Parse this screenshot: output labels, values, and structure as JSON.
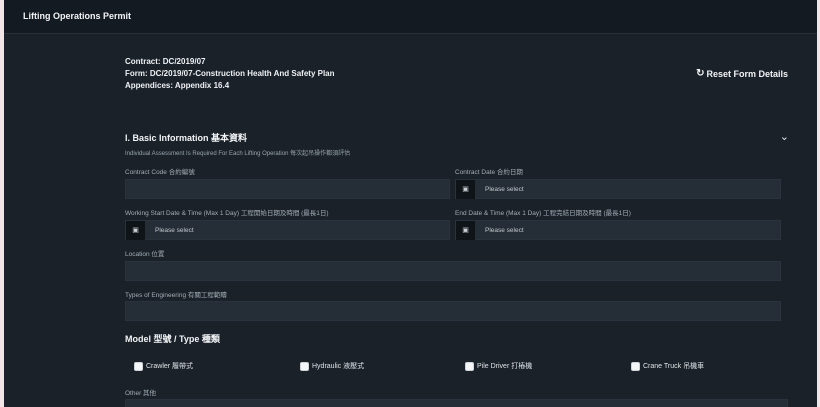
{
  "app": {
    "title": "Lifting Operations Permit"
  },
  "meta": {
    "contract": "Contract: DC/2019/07",
    "form": "Form: DC/2019/07-Construction Health And Safety Plan",
    "appendices": "Appendices: Appendix 16.4"
  },
  "actions": {
    "reset_label": "Reset Form Details",
    "reset_icon": "refresh-icon"
  },
  "section": {
    "title": "I. Basic Information 基本資料",
    "note": "Individual Assessment Is Required For Each Lifting Operation 每次起吊操作都須評估",
    "fields": {
      "contract_code": {
        "label": "Contract Code 合約編號",
        "value": ""
      },
      "contract_date": {
        "label": "Contract Date 合約日期",
        "placeholder": "Please select"
      },
      "start": {
        "label": "Working Start Date & Time (Max 1 Day) 工程開始日期及時間 (最長1日)",
        "placeholder": "Please select"
      },
      "end": {
        "label": "End Date & Time (Max 1 Day) 工程完結日期及時間 (最長1日)",
        "placeholder": "Please select"
      },
      "location": {
        "label": "Location 位置",
        "value": ""
      },
      "engineering": {
        "label": "Types of Engineering 有關工程範疇",
        "value": ""
      }
    }
  },
  "model": {
    "title": "Model 型號 / Type 種類",
    "options": [
      "Crawler 履帶式",
      "Hydraulic 液壓式",
      "Pile Driver 打樁機",
      "Crane Truck 吊機車"
    ],
    "other_label": "Other 其他"
  },
  "colors": {
    "background": "#1a2129",
    "input": "#252d36",
    "accent": "#f2f4f6"
  }
}
